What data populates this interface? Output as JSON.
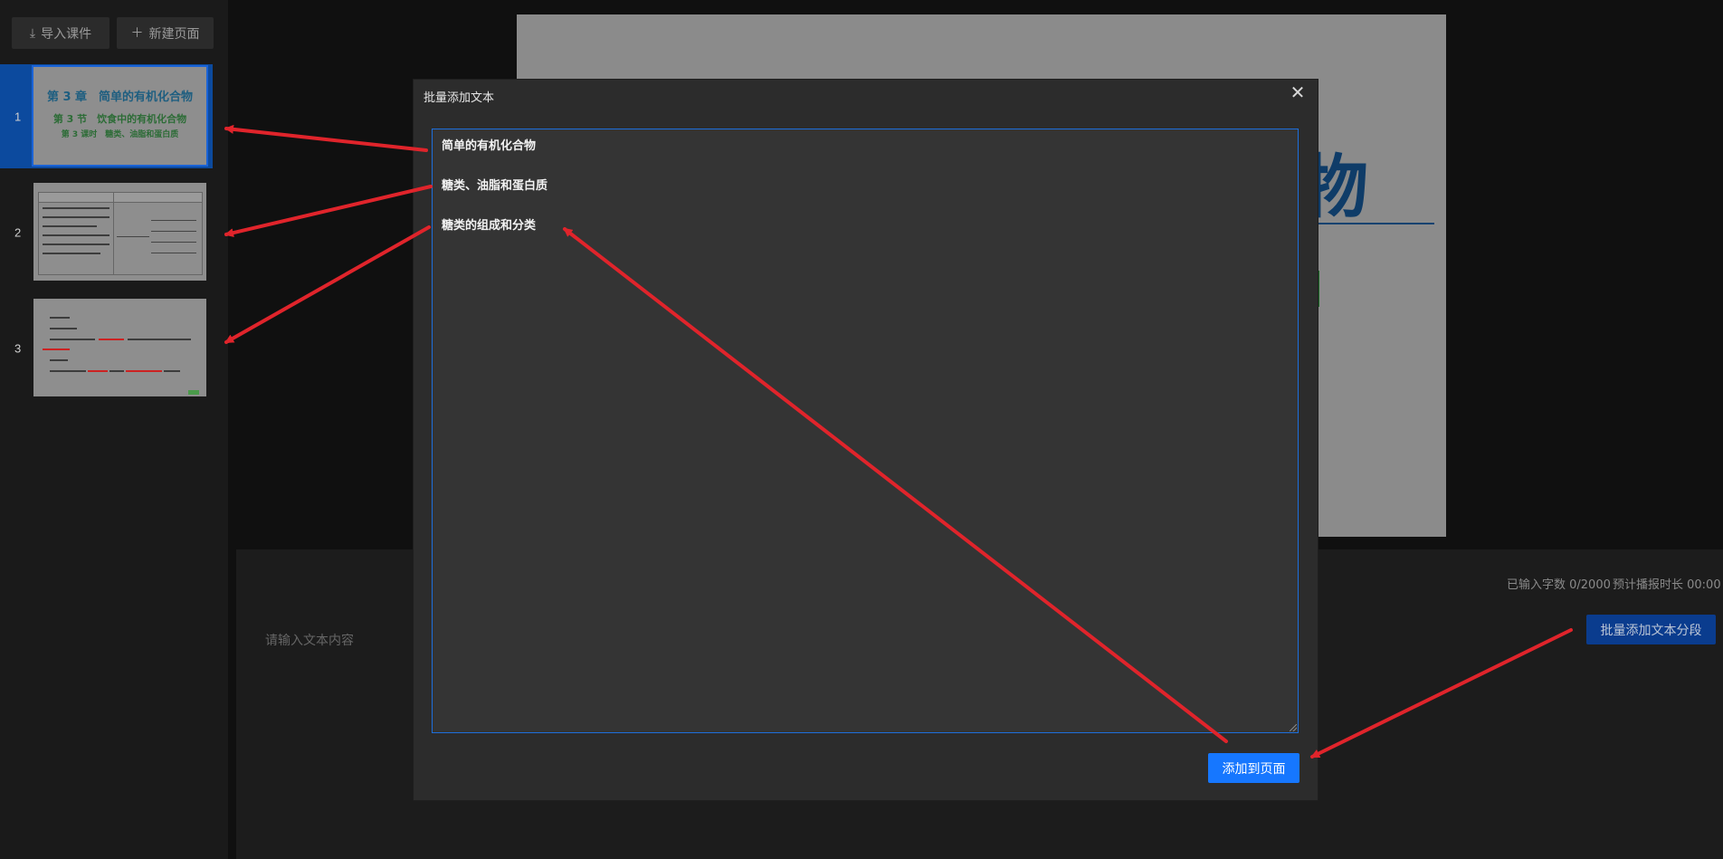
{
  "left_panel": {
    "import_button": "导入课件",
    "new_page_button": "新建页面",
    "slides": [
      {
        "number": "1",
        "title": "第 3 章　简单的有机化合物",
        "section": "第 3 节　饮食中的有机化合物",
        "lesson": "第 3 课时　糖类、油脂和蛋白质"
      },
      {
        "number": "2"
      },
      {
        "number": "3"
      }
    ]
  },
  "main": {
    "text_placeholder": "请输入文本内容",
    "char_count": "已输入字数 0/2000",
    "duration": "预计播报时长 00:00",
    "batch_segment_button": "批量添加文本分段",
    "background_title_glyph": "物"
  },
  "modal": {
    "title": "批量添加文本",
    "lines": [
      "简单的有机化合物",
      "糖类、油脂和蛋白质",
      "糖类的组成和分类"
    ],
    "add_button": "添加到页面"
  },
  "colors": {
    "accent": "#1677ff",
    "active_slide": "#0c4a9e",
    "annotation_arrow": "#e0242b"
  }
}
